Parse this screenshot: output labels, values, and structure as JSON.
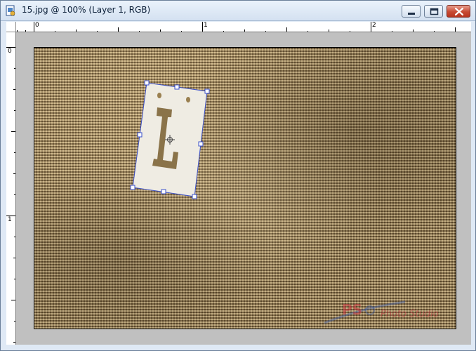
{
  "window": {
    "title": "15.jpg @ 100% (Layer 1, RGB)",
    "icons": [
      "document-icon",
      "minimize-icon",
      "maximize-icon",
      "close-icon"
    ]
  },
  "rulers": {
    "units": "inches",
    "top_labels": [
      "0",
      "1",
      "2"
    ],
    "left_labels": [
      "0",
      "1"
    ]
  },
  "layer": {
    "glyph": "L",
    "card_color": "#efece3"
  },
  "watermark": {
    "text": "Photo Studio"
  },
  "colors": {
    "close_button": "#c74a33",
    "canvas_gray": "#c0c0c0",
    "burlap": "#8c7650",
    "handle_blue": "#3a4fc9"
  }
}
